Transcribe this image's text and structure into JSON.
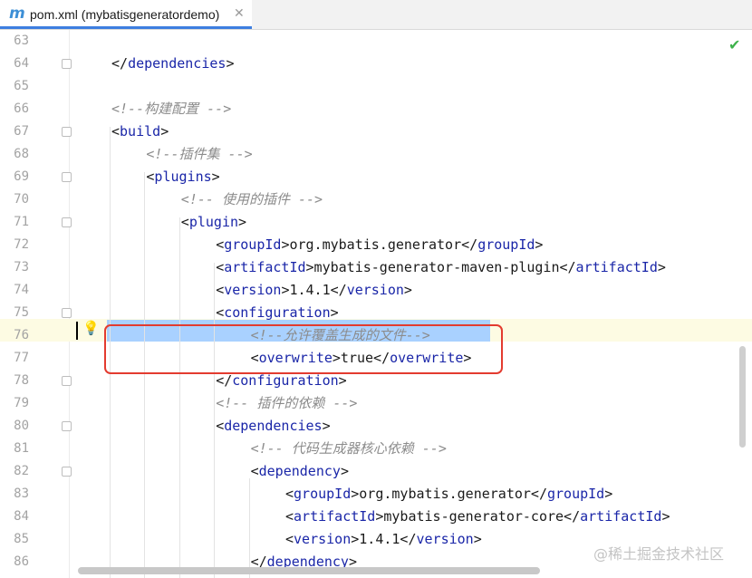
{
  "tab": {
    "icon_glyph": "m",
    "title": "pom.xml (mybatisgeneratordemo)",
    "close_glyph": "✕"
  },
  "status": {
    "check_glyph": "✔"
  },
  "watermark": "@稀土掘金技术社区",
  "lines": [
    {
      "num": "63",
      "segs": []
    },
    {
      "num": "64",
      "segs": [
        {
          "t": "p",
          "v": "</"
        },
        {
          "t": "tag",
          "v": "dependencies"
        },
        {
          "t": "p",
          "v": ">"
        }
      ]
    },
    {
      "num": "65",
      "segs": []
    },
    {
      "num": "66",
      "segs": [
        {
          "t": "cmt",
          "v": "<!--构建配置 -->"
        }
      ]
    },
    {
      "num": "67",
      "segs": [
        {
          "t": "p",
          "v": "<"
        },
        {
          "t": "tag",
          "v": "build"
        },
        {
          "t": "p",
          "v": ">"
        }
      ]
    },
    {
      "num": "68",
      "segs": [
        {
          "t": "cmt",
          "v": "<!--插件集 -->"
        }
      ]
    },
    {
      "num": "69",
      "segs": [
        {
          "t": "p",
          "v": "<"
        },
        {
          "t": "tag",
          "v": "plugins"
        },
        {
          "t": "p",
          "v": ">"
        }
      ]
    },
    {
      "num": "70",
      "segs": [
        {
          "t": "cmt",
          "v": "<!-- 使用的插件 -->"
        }
      ]
    },
    {
      "num": "71",
      "segs": [
        {
          "t": "p",
          "v": "<"
        },
        {
          "t": "tag",
          "v": "plugin"
        },
        {
          "t": "p",
          "v": ">"
        }
      ]
    },
    {
      "num": "72",
      "segs": [
        {
          "t": "p",
          "v": "<"
        },
        {
          "t": "tag",
          "v": "groupId"
        },
        {
          "t": "p",
          "v": ">org.mybatis.generator</"
        },
        {
          "t": "tag",
          "v": "groupId"
        },
        {
          "t": "p",
          "v": ">"
        }
      ]
    },
    {
      "num": "73",
      "segs": [
        {
          "t": "p",
          "v": "<"
        },
        {
          "t": "tag",
          "v": "artifactId"
        },
        {
          "t": "p",
          "v": ">mybatis-generator-maven-plugin</"
        },
        {
          "t": "tag",
          "v": "artifactId"
        },
        {
          "t": "p",
          "v": ">"
        }
      ]
    },
    {
      "num": "74",
      "segs": [
        {
          "t": "p",
          "v": "<"
        },
        {
          "t": "tag",
          "v": "version"
        },
        {
          "t": "p",
          "v": ">1.4.1</"
        },
        {
          "t": "tag",
          "v": "version"
        },
        {
          "t": "p",
          "v": ">"
        }
      ]
    },
    {
      "num": "75",
      "segs": [
        {
          "t": "p",
          "v": "<"
        },
        {
          "t": "tag",
          "v": "configuration"
        },
        {
          "t": "p",
          "v": ">"
        }
      ]
    },
    {
      "num": "76",
      "segs": [
        {
          "t": "cmt",
          "v": "<!--允许覆盖生成的文件-->"
        }
      ]
    },
    {
      "num": "77",
      "segs": [
        {
          "t": "p",
          "v": "<"
        },
        {
          "t": "tag",
          "v": "overwrite"
        },
        {
          "t": "p",
          "v": ">true</"
        },
        {
          "t": "tag",
          "v": "overwrite"
        },
        {
          "t": "p",
          "v": ">"
        }
      ]
    },
    {
      "num": "78",
      "segs": [
        {
          "t": "p",
          "v": "</"
        },
        {
          "t": "tag",
          "v": "configuration"
        },
        {
          "t": "p",
          "v": ">"
        }
      ]
    },
    {
      "num": "79",
      "segs": [
        {
          "t": "cmt",
          "v": "<!-- 插件的依赖 -->"
        }
      ]
    },
    {
      "num": "80",
      "segs": [
        {
          "t": "p",
          "v": "<"
        },
        {
          "t": "tag",
          "v": "dependencies"
        },
        {
          "t": "p",
          "v": ">"
        }
      ]
    },
    {
      "num": "81",
      "segs": [
        {
          "t": "cmt",
          "v": "<!-- 代码生成器核心依赖 -->"
        }
      ]
    },
    {
      "num": "82",
      "segs": [
        {
          "t": "p",
          "v": "<"
        },
        {
          "t": "tag",
          "v": "dependency"
        },
        {
          "t": "p",
          "v": ">"
        }
      ]
    },
    {
      "num": "83",
      "segs": [
        {
          "t": "p",
          "v": "<"
        },
        {
          "t": "tag",
          "v": "groupId"
        },
        {
          "t": "p",
          "v": ">org.mybatis.generator</"
        },
        {
          "t": "tag",
          "v": "groupId"
        },
        {
          "t": "p",
          "v": ">"
        }
      ]
    },
    {
      "num": "84",
      "segs": [
        {
          "t": "p",
          "v": "<"
        },
        {
          "t": "tag",
          "v": "artifactId"
        },
        {
          "t": "p",
          "v": ">mybatis-generator-core</"
        },
        {
          "t": "tag",
          "v": "artifactId"
        },
        {
          "t": "p",
          "v": ">"
        }
      ]
    },
    {
      "num": "85",
      "segs": [
        {
          "t": "p",
          "v": "<"
        },
        {
          "t": "tag",
          "v": "version"
        },
        {
          "t": "p",
          "v": ">1.4.1</"
        },
        {
          "t": "tag",
          "v": "version"
        },
        {
          "t": "p",
          "v": ">"
        }
      ]
    },
    {
      "num": "86",
      "segs": [
        {
          "t": "p",
          "v": "</"
        },
        {
          "t": "tag",
          "v": "dependency"
        },
        {
          "t": "p",
          "v": ">"
        }
      ]
    }
  ]
}
